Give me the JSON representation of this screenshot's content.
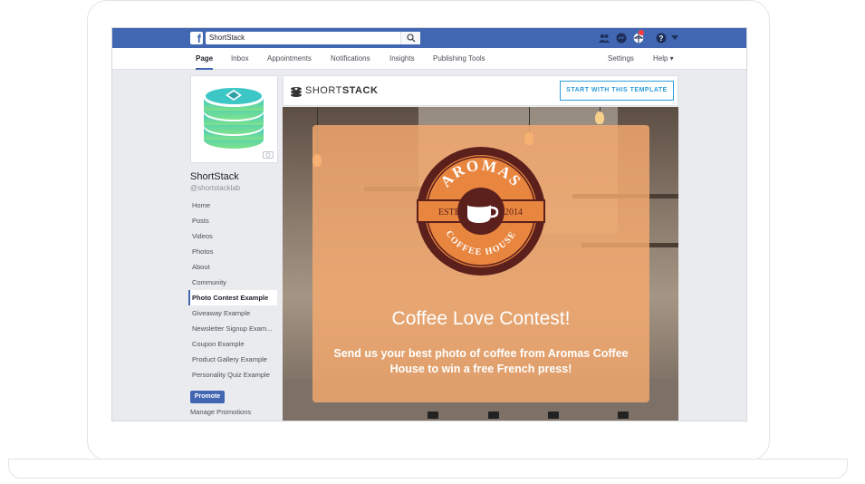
{
  "facebook": {
    "search_value": "ShortStack",
    "tabs": [
      "Page",
      "Inbox",
      "Appointments",
      "Notifications",
      "Insights",
      "Publishing Tools"
    ],
    "right_tabs": [
      "Settings",
      "Help ▾"
    ]
  },
  "page": {
    "name": "ShortStack",
    "handle": "@shortstacklab",
    "nav": [
      "Home",
      "Posts",
      "Videos",
      "Photos",
      "About",
      "Community",
      "Photo Contest Example",
      "Giveaway Example",
      "Newsletter Signup Exam...",
      "Coupon Example",
      "Product Gallery Example",
      "Personality Quiz Example"
    ],
    "active_nav_index": 6,
    "promote_label": "Promote",
    "manage_label": "Manage Promotions"
  },
  "app": {
    "logo_prefix": "SHORT",
    "logo_suffix": "STACK",
    "template_button": "START WITH THIS TEMPLATE",
    "badge_top": "AROMAS",
    "badge_bottom": "COFFEE HOUSE",
    "badge_left": "ESTB",
    "badge_right": "2014",
    "title": "Coffee Love Contest!",
    "description": "Send us your best photo of coffee from Aromas Coffee House to win a free French press!"
  },
  "colors": {
    "fb_blue": "#4267b2",
    "accent_blue": "#2d9cdb",
    "overlay_orange": "#f5aa6e",
    "badge_maroon": "#5b1f1c",
    "badge_orange": "#e8853e",
    "logo_teal": "#3cc6c6",
    "logo_green": "#7ee28b"
  },
  "icons": [
    "facebook-icon",
    "search-icon",
    "friends-icon",
    "messenger-icon",
    "globe-icon",
    "help-icon",
    "camera-icon",
    "shortstack-logo-icon",
    "coffee-cup-icon"
  ]
}
